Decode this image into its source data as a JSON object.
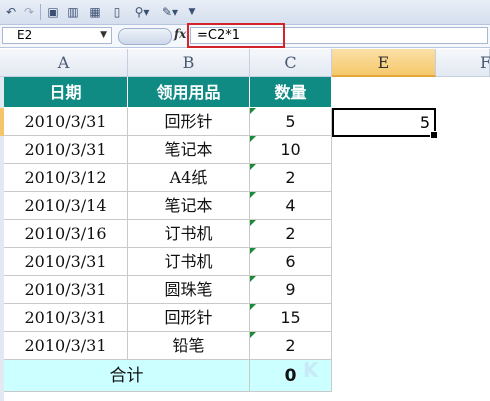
{
  "toolbar": {
    "icons": [
      "undo-icon",
      "redo-icon",
      "save-icon",
      "chart-icon",
      "table-icon",
      "new-doc-icon",
      "search-dropdown-icon",
      "edit-icon",
      "more-icon"
    ]
  },
  "formula_bar": {
    "name_box": "E2",
    "fx_label": "fx",
    "formula": "=C2*1"
  },
  "columns": [
    "A",
    "B",
    "C",
    "E",
    "F"
  ],
  "table": {
    "headers": [
      "日期",
      "领用用品",
      "数量"
    ],
    "rows": [
      {
        "date": "2010/3/31",
        "item": "回形针",
        "qty": "5"
      },
      {
        "date": "2010/3/31",
        "item": "笔记本",
        "qty": "10"
      },
      {
        "date": "2010/3/12",
        "item": "A4纸",
        "qty": "2"
      },
      {
        "date": "2010/3/14",
        "item": "笔记本",
        "qty": "4"
      },
      {
        "date": "2010/3/16",
        "item": "订书机",
        "qty": "2"
      },
      {
        "date": "2010/3/31",
        "item": "订书机",
        "qty": "6"
      },
      {
        "date": "2010/3/31",
        "item": "圆珠笔",
        "qty": "9"
      },
      {
        "date": "2010/3/31",
        "item": "回形针",
        "qty": "15"
      },
      {
        "date": "2010/3/31",
        "item": "铅笔",
        "qty": "2"
      }
    ],
    "total_label": "合计",
    "total_value": "0"
  },
  "active_cell": {
    "value": "5"
  },
  "watermark": "K"
}
